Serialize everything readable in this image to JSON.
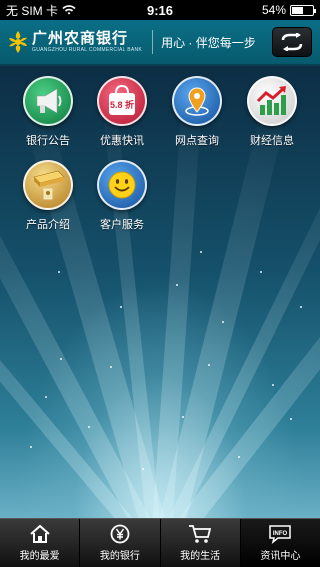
{
  "status": {
    "carrier": "无 SIM 卡",
    "time": "9:16",
    "battery_text": "54%",
    "battery_level": 0.54
  },
  "header": {
    "logo_cn": "广州农商银行",
    "logo_en": "GUANGZHOU RURAL COMMERCIAL BANK",
    "slogan": "用心 · 伴您每一步",
    "switch_icon": "switch-arrows-icon"
  },
  "tiles": [
    {
      "label": "银行公告",
      "icon": "megaphone-icon",
      "color": "#1aa05a"
    },
    {
      "label": "优惠快讯",
      "icon": "shopping-bag-icon",
      "color": "#e0304a",
      "badge": "5.8 折"
    },
    {
      "label": "网点查询",
      "icon": "map-pin-icon",
      "color": "#2a78c8"
    },
    {
      "label": "财经信息",
      "icon": "chart-icon",
      "color": "#e8e8e8"
    },
    {
      "label": "产品介绍",
      "icon": "gold-icon",
      "color": "#d9a43a"
    },
    {
      "label": "客户服务",
      "icon": "smiley-icon",
      "color": "#2a78c8"
    }
  ],
  "tabs": [
    {
      "label": "我的最爱",
      "icon": "home-icon",
      "active": false
    },
    {
      "label": "我的银行",
      "icon": "yen-coin-icon",
      "active": false
    },
    {
      "label": "我的生活",
      "icon": "cart-icon",
      "active": false
    },
    {
      "label": "资讯中心",
      "icon": "info-icon",
      "active": true
    }
  ]
}
